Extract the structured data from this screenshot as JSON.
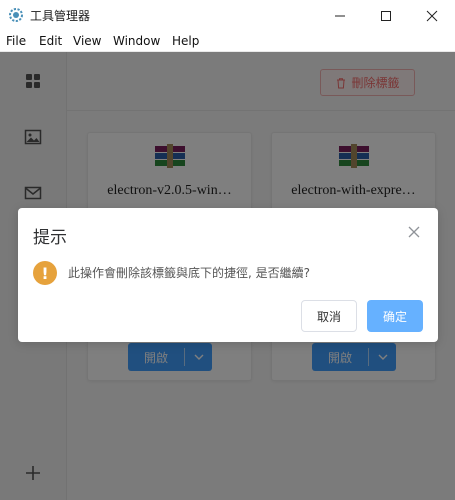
{
  "window": {
    "title": "工具管理器"
  },
  "menu": [
    "File",
    "Edit",
    "View",
    "Window",
    "Help"
  ],
  "sidebar": {
    "icons": [
      "grid-icon",
      "image-icon",
      "mail-icon"
    ],
    "add_icon": "plus-icon"
  },
  "toolbar": {
    "delete_label": "刪除標籤"
  },
  "cards": [
    {
      "title": "electron-v2.0.5-win…",
      "open_label": "開啟"
    },
    {
      "title": "electron-with-expre…",
      "open_label": "開啟"
    }
  ],
  "dialog": {
    "title": "提示",
    "message": "此操作會刪除該標籤與底下的捷徑, 是否繼續?",
    "cancel_label": "取消",
    "confirm_label": "确定"
  },
  "colors": {
    "primary": "#409eff",
    "primary_light": "#66b1ff",
    "danger": "#f56c6c",
    "warning": "#e6a23c"
  }
}
